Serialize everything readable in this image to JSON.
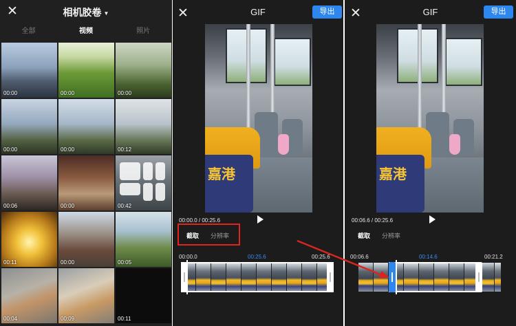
{
  "gallery": {
    "title": "相机胶卷",
    "tabs": [
      "全部",
      "视频",
      "照片"
    ],
    "active_tab": "视频",
    "thumbnails": [
      {
        "duration": "00:00"
      },
      {
        "duration": "00:00"
      },
      {
        "duration": "00:00"
      },
      {
        "duration": "00:00"
      },
      {
        "duration": "00:00"
      },
      {
        "duration": "00:12"
      },
      {
        "duration": "00:06"
      },
      {
        "duration": "00:00"
      },
      {
        "duration": "00:42"
      },
      {
        "duration": "00:11"
      },
      {
        "duration": "00:00"
      },
      {
        "duration": "00:05"
      },
      {
        "duration": "00:04"
      },
      {
        "duration": "00:09"
      },
      {
        "duration": "00:11"
      },
      {
        "duration": ""
      }
    ]
  },
  "editor_left": {
    "title": "GIF",
    "export_label": "导出",
    "time_readout": "00:00.0  /  00:25.6",
    "tabs": [
      "截取",
      "分辨率"
    ],
    "timeline": {
      "start": "00:00.0",
      "selected": "00:25.6",
      "end": "00:25.6"
    },
    "seat_text": "嘉港"
  },
  "editor_right": {
    "title": "GIF",
    "export_label": "导出",
    "time_readout": "00:06.6  /  00:25.6",
    "tabs": [
      "截取",
      "分辨率"
    ],
    "timeline": {
      "start": "00:06.6",
      "selected": "00:14.6",
      "end": "00:21.2"
    },
    "seat_text": "嘉港"
  },
  "colors": {
    "accent": "#2e86ef",
    "highlight_box": "#e4241e",
    "annotation_arrow": "#d8261f"
  }
}
